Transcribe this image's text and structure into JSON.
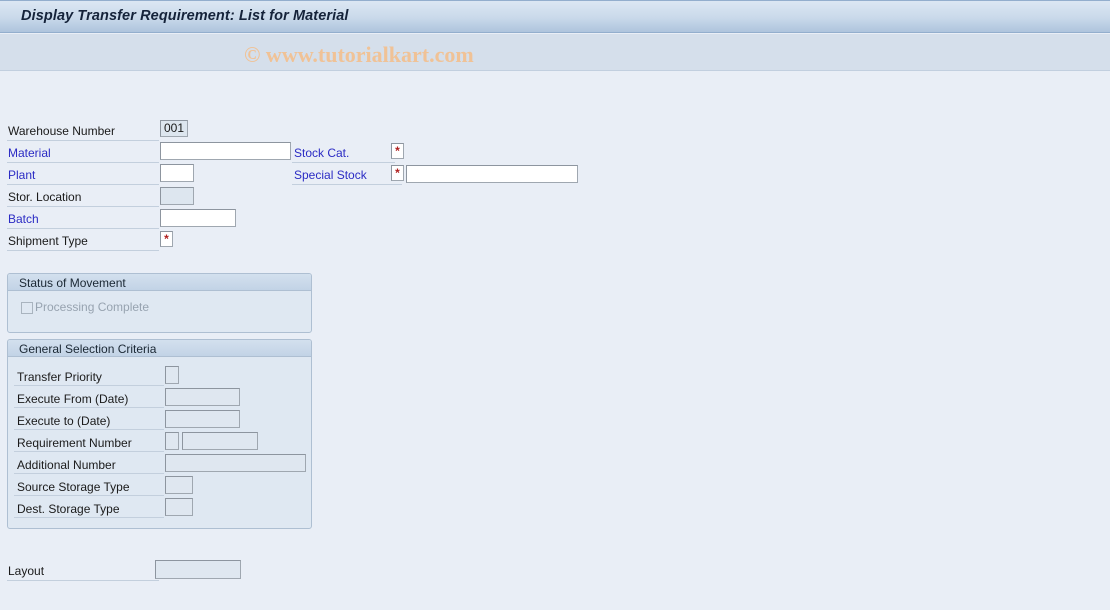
{
  "window": {
    "title": "Display Transfer Requirement: List for Material",
    "watermark": "© www.tutorialkart.com"
  },
  "form": {
    "warehouse_number": {
      "label": "Warehouse Number",
      "value": "001"
    },
    "material": {
      "label": "Material",
      "value": ""
    },
    "plant": {
      "label": "Plant",
      "value": ""
    },
    "stor_location": {
      "label": "Stor. Location",
      "value": ""
    },
    "batch": {
      "label": "Batch",
      "value": ""
    },
    "shipment_type": {
      "label": "Shipment Type",
      "value": "*"
    },
    "stock_cat": {
      "label": "Stock Cat.",
      "value": "*"
    },
    "special_stock": {
      "label": "Special Stock",
      "value": "*",
      "extra_value": ""
    }
  },
  "status_of_movement": {
    "title": "Status of Movement",
    "processing_complete": {
      "label": "Processing Complete",
      "checked": false
    }
  },
  "general_selection_criteria": {
    "title": "General Selection Criteria",
    "rows": [
      {
        "label": "Transfer Priority",
        "value": ""
      },
      {
        "label": "Execute From (Date)",
        "value": ""
      },
      {
        "label": "Execute to (Date)",
        "value": ""
      },
      {
        "label": "Requirement Number",
        "value": "",
        "extra_value": ""
      },
      {
        "label": "Additional Number",
        "value": ""
      },
      {
        "label": "Source Storage Type",
        "value": ""
      },
      {
        "label": "Dest. Storage Type",
        "value": ""
      }
    ]
  },
  "layout": {
    "label": "Layout",
    "value": ""
  },
  "colors": {
    "page_background": "#e9eef6",
    "title_bar": "#aec4dd",
    "link_label": "#2b2bc4",
    "required_marker": "#b02020",
    "watermark": "#f0c296",
    "group_box": "#dfe8f2"
  }
}
